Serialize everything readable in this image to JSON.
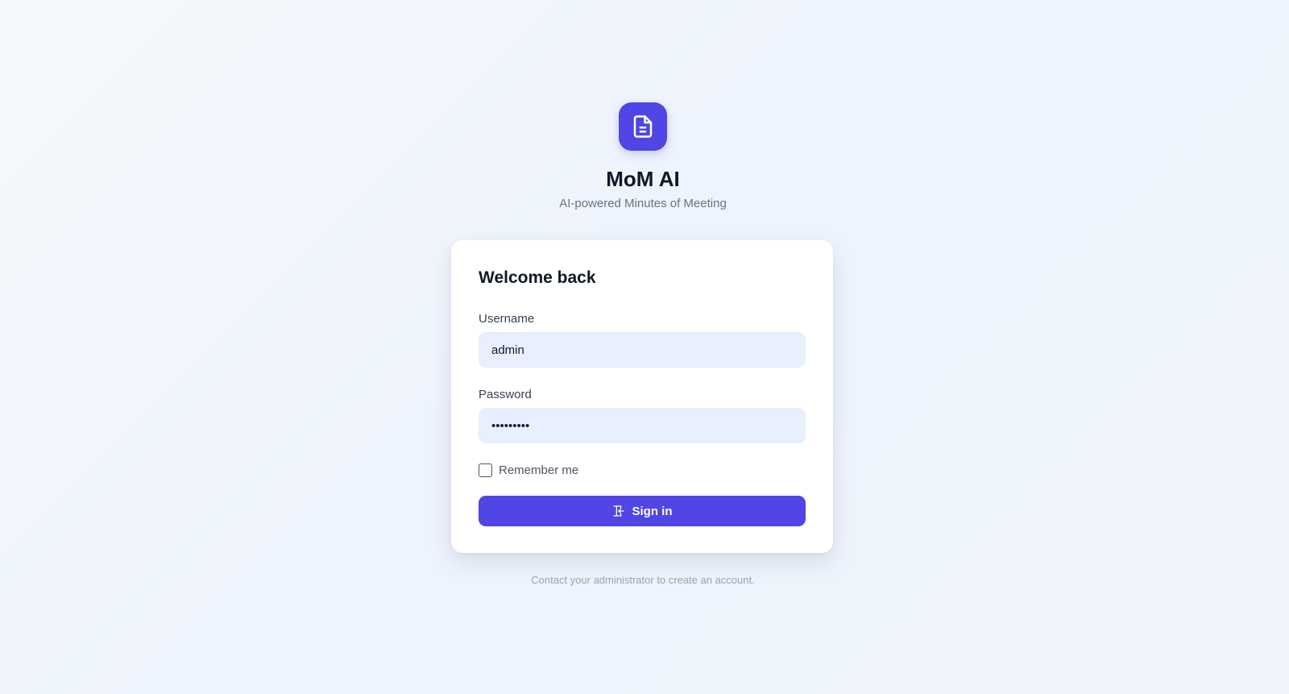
{
  "brand": {
    "logo_icon": "document-icon",
    "title": "MoM AI",
    "subtitle": "AI-powered Minutes of Meeting",
    "accent_color": "#4f46e5"
  },
  "login_card": {
    "heading": "Welcome back",
    "username": {
      "label": "Username",
      "value": "admin"
    },
    "password": {
      "label": "Password",
      "value": "•••••••••"
    },
    "remember_me": {
      "label": "Remember me",
      "checked": false
    },
    "sign_in_button": {
      "label": "Sign in",
      "icon": "log-in-icon"
    }
  },
  "footer": {
    "note": "Contact your administrator to create an account."
  }
}
